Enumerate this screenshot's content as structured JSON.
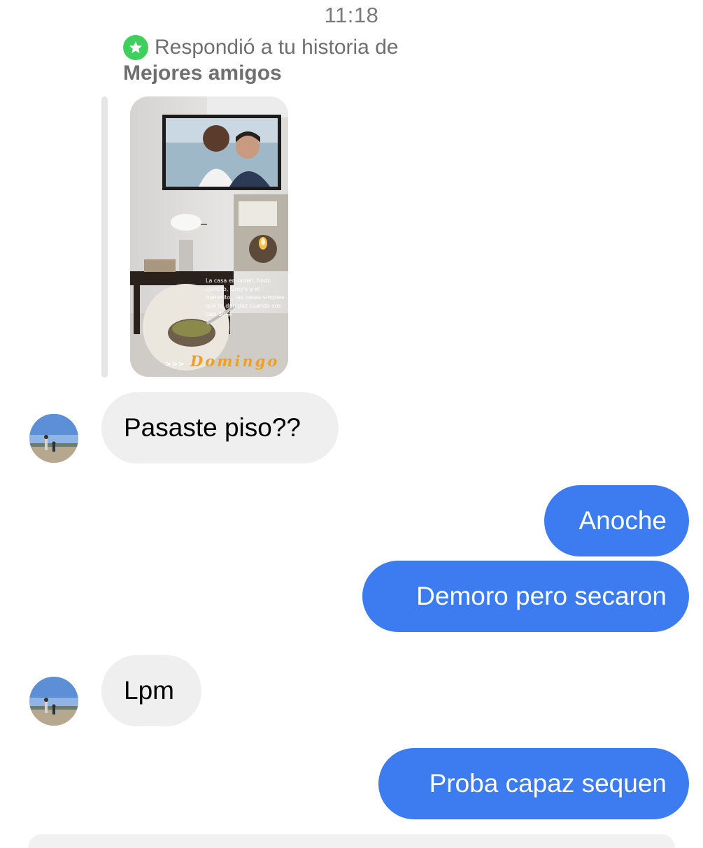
{
  "status": {
    "time": "11:18"
  },
  "story_reply": {
    "header_line1": "Respondió a tu historia de",
    "header_line2": "Mejores amigos",
    "badge_icon": "star-icon",
    "badge_color": "#3fcf5c",
    "story": {
      "caption": "La casa en orden, lindo olorcito, Grey's y el matecito.. las cosas simples que te dan paz cuando sos casi 30😂",
      "arrows": ">>>",
      "day_label": "Domingo"
    }
  },
  "messages": [
    {
      "direction": "incoming",
      "text": "Pasaste piso??",
      "show_avatar": true
    },
    {
      "direction": "outgoing",
      "text": "Anoche"
    },
    {
      "direction": "outgoing",
      "text": "Demoro pero secaron"
    },
    {
      "direction": "incoming",
      "text": "Lpm",
      "show_avatar": true
    },
    {
      "direction": "outgoing",
      "text": "Proba capaz sequen"
    }
  ],
  "colors": {
    "outgoing_bubble": "#3d7bf0",
    "incoming_bubble": "#efefef",
    "timestamp_text": "#7a7a7a"
  }
}
